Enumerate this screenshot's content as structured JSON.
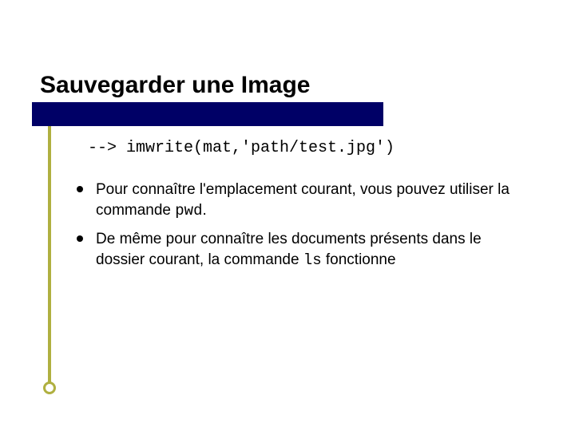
{
  "title": "Sauvegarder une Image",
  "code_line": "--> imwrite(mat,'path/test.jpg')",
  "bullets": [
    {
      "pre": "Pour connaître l'emplacement courant, vous pouvez utiliser la commande ",
      "code": "pwd",
      "post": "."
    },
    {
      "pre": "De même pour connaître les documents présents dans le dossier courant, la commande ",
      "code": "ls",
      "post": " fonctionne"
    }
  ]
}
